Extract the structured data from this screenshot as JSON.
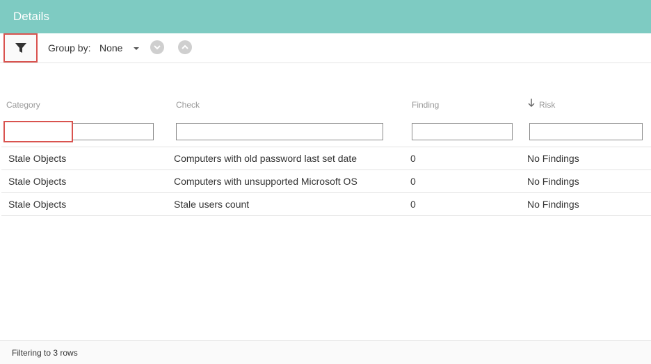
{
  "header": {
    "title": "Details"
  },
  "toolbar": {
    "filter_icon": "filter-icon",
    "group_by_label": "Group by:",
    "group_by_value": "None",
    "expand_all_icon": "chevron-down-circle-icon",
    "collapse_all_icon": "chevron-up-circle-icon"
  },
  "table": {
    "columns": [
      {
        "label": "Category"
      },
      {
        "label": "Check"
      },
      {
        "label": "Finding"
      },
      {
        "label": "Risk",
        "sorted": "descending",
        "sort_icon": "arrow-down-icon"
      }
    ],
    "filters": {
      "category": "Stale Objects",
      "check": "",
      "finding": "",
      "risk": ""
    },
    "rows": [
      {
        "category": "Stale Objects",
        "check": "Computers with old password last set date",
        "finding": "0",
        "risk": "No Findings"
      },
      {
        "category": "Stale Objects",
        "check": "Computers with unsupported Microsoft OS",
        "finding": "0",
        "risk": "No Findings"
      },
      {
        "category": "Stale Objects",
        "check": "Stale users count",
        "finding": "0",
        "risk": "No Findings"
      }
    ]
  },
  "footer": {
    "status": "Filtering to 3 rows"
  },
  "colors": {
    "header_bg": "#7ecbc2",
    "highlight": "#d9534f",
    "circle_button": "#cfcfcf"
  }
}
